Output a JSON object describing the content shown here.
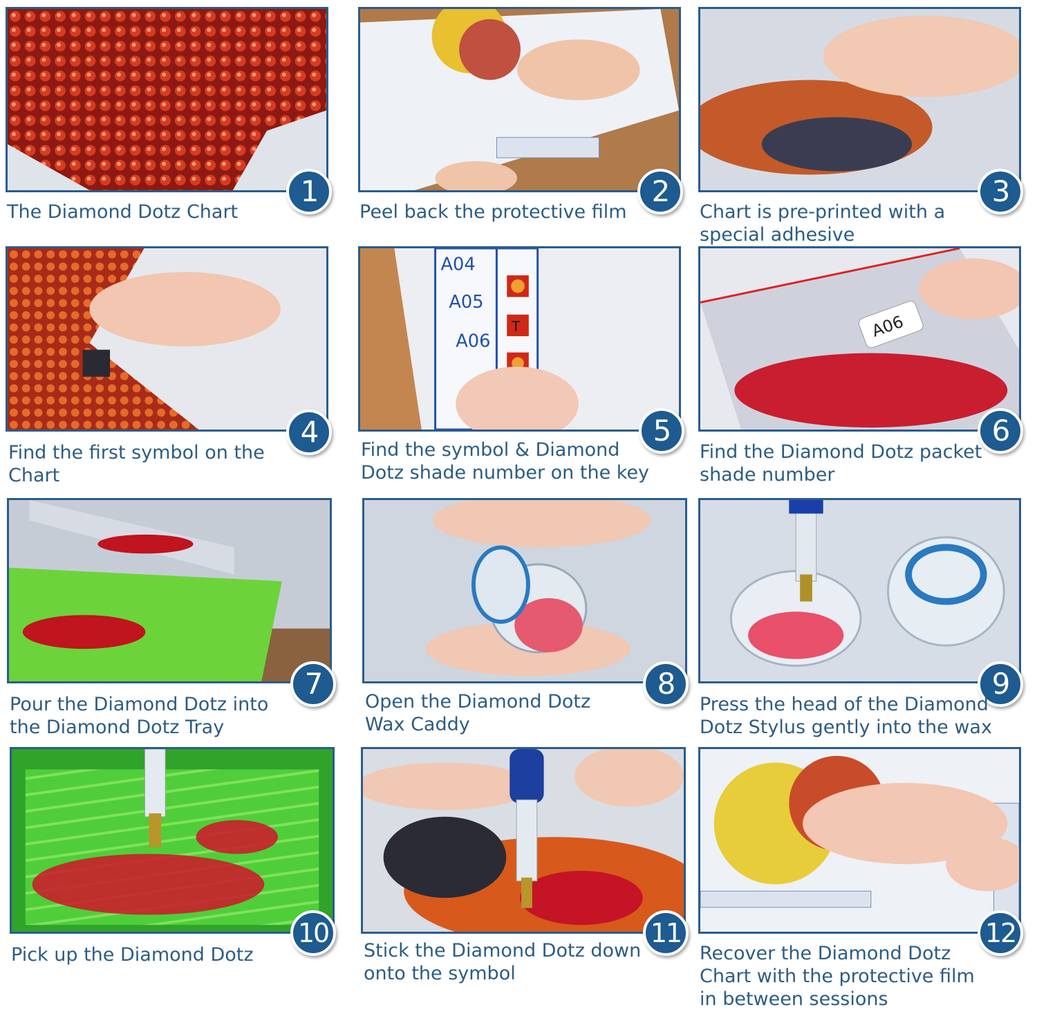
{
  "steps": [
    {
      "number": "1",
      "caption": "The Diamond Dotz Chart"
    },
    {
      "number": "2",
      "caption": "Peel back the protective film"
    },
    {
      "number": "3",
      "caption": "Chart is pre-printed with a\nspecial adhesive"
    },
    {
      "number": "4",
      "caption": "Find the first symbol on the\nChart"
    },
    {
      "number": "5",
      "caption": "Find the symbol & Diamond\nDotz shade number on the key"
    },
    {
      "number": "6",
      "caption": "Find the Diamond Dotz packet\nshade number"
    },
    {
      "number": "7",
      "caption": "Pour the Diamond Dotz into\nthe Diamond Dotz Tray"
    },
    {
      "number": "8",
      "caption": "Open the Diamond Dotz\nWax Caddy"
    },
    {
      "number": "9",
      "caption": "Press the head of the Diamond\nDotz Stylus gently into the wax"
    },
    {
      "number": "10",
      "caption": "Pick up the Diamond Dotz"
    },
    {
      "number": "11",
      "caption": "Stick the Diamond Dotz down\nonto the symbol"
    },
    {
      "number": "12",
      "caption": "Recover the Diamond Dotz\nChart with the protective film\nin between sessions"
    }
  ],
  "photo_text": {
    "key_codes": [
      "A04",
      "A05",
      "A06"
    ],
    "key_symbol": "T",
    "packet_label": "A06"
  },
  "colors": {
    "frame": "#2a5d8c",
    "badge": "#1d5b90",
    "caption": "#2c5c84"
  }
}
